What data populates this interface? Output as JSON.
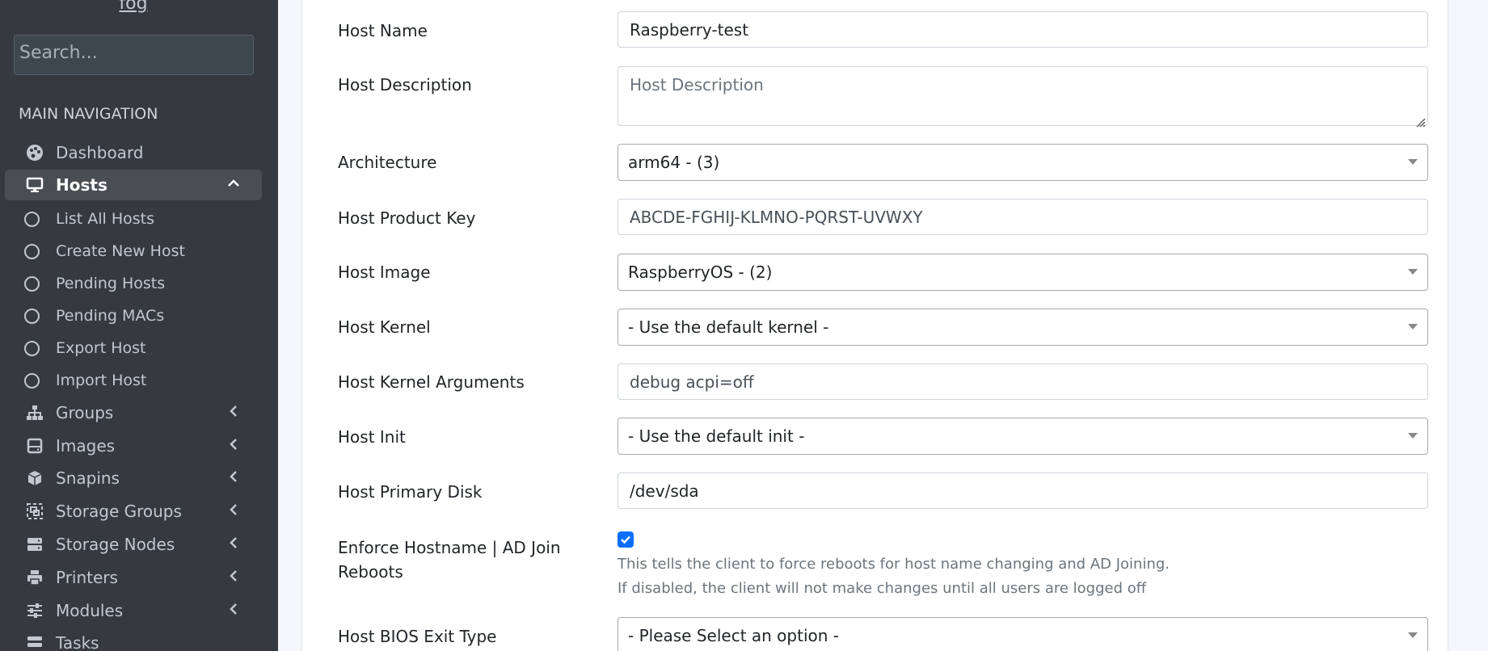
{
  "sidebar": {
    "brand": "fog",
    "search_placeholder": "Search...",
    "header": "MAIN NAVIGATION",
    "items": {
      "dashboard": "Dashboard",
      "hosts": "Hosts",
      "groups": "Groups",
      "images": "Images",
      "snapins": "Snapins",
      "storage_groups": "Storage Groups",
      "storage_nodes": "Storage Nodes",
      "printers": "Printers",
      "modules": "Modules",
      "tasks": "Tasks"
    },
    "hosts_sub": {
      "list_all": "List All Hosts",
      "create_new": "Create New Host",
      "pending_hosts": "Pending Hosts",
      "pending_macs": "Pending MACs",
      "export": "Export Host",
      "import": "Import Host"
    }
  },
  "form": {
    "host_name": {
      "label": "Host Name",
      "value": "Raspberry-test"
    },
    "host_description": {
      "label": "Host Description",
      "placeholder": "Host Description"
    },
    "architecture": {
      "label": "Architecture",
      "value": "arm64 - (3)"
    },
    "product_key": {
      "label": "Host Product Key",
      "value": "ABCDE-FGHIJ-KLMNO-PQRST-UVWXY"
    },
    "host_image": {
      "label": "Host Image",
      "value": "RaspberryOS - (2)"
    },
    "host_kernel": {
      "label": "Host Kernel",
      "value": "- Use the default kernel -"
    },
    "kernel_args": {
      "label": "Host Kernel Arguments",
      "value": "debug acpi=off"
    },
    "host_init": {
      "label": "Host Init",
      "value": "- Use the default init -"
    },
    "primary_disk": {
      "label": "Host Primary Disk",
      "value": "/dev/sda"
    },
    "enforce": {
      "label_line1": "Enforce Hostname | AD Join",
      "label_line2": "Reboots",
      "checked": true,
      "help_line1": "This tells the client to force reboots for host name changing and AD Joining.",
      "help_line2": "If disabled, the client will not make changes until all users are logged off"
    },
    "bios_exit": {
      "label": "Host BIOS Exit Type",
      "value": "- Please Select an option -"
    }
  },
  "colors": {
    "sidebar_bg": "#343a40",
    "active_item_bg": "#494e53",
    "checkbox": "#0d6efd"
  },
  "icons": {
    "dashboard": "palette-icon",
    "hosts": "desktop-icon",
    "groups": "sitemap-icon",
    "images": "hdd-icon",
    "snapins": "cube-icon",
    "storage_groups": "object-group-icon",
    "storage_nodes": "server-icon",
    "printers": "print-icon",
    "modules": "sliders-icon",
    "tasks": "tasks-icon"
  }
}
